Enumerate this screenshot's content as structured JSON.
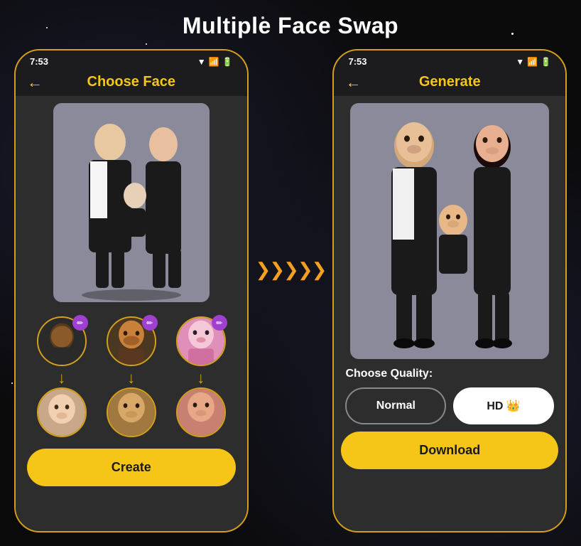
{
  "page": {
    "title": "Multiple Face Swap",
    "background_color": "#0a0a0a"
  },
  "left_phone": {
    "status_time": "7:53",
    "header_title": "Choose Face",
    "back_label": "←",
    "create_button": "Create",
    "face_sources": [
      {
        "id": "face1",
        "label": "dark face",
        "color": "#2a2a2a"
      },
      {
        "id": "face2",
        "label": "beard face",
        "color": "#5a4020"
      },
      {
        "id": "face3",
        "label": "pink face",
        "color": "#e090b0"
      }
    ],
    "face_targets": [
      {
        "id": "target1",
        "label": "baby face",
        "color": "#d0a888"
      },
      {
        "id": "target2",
        "label": "man face",
        "color": "#c8a060"
      },
      {
        "id": "target3",
        "label": "woman face",
        "color": "#d89070"
      }
    ]
  },
  "right_phone": {
    "status_time": "7:53",
    "header_title": "Generate",
    "back_label": "←",
    "quality_label": "Choose Quality:",
    "quality_options": [
      {
        "id": "normal",
        "label": "Normal",
        "selected": true
      },
      {
        "id": "hd",
        "label": "HD 👑",
        "selected": false
      }
    ],
    "download_button": "Download"
  },
  "arrow_symbol": "❯❯❯❯❯",
  "edit_icon": "✏"
}
